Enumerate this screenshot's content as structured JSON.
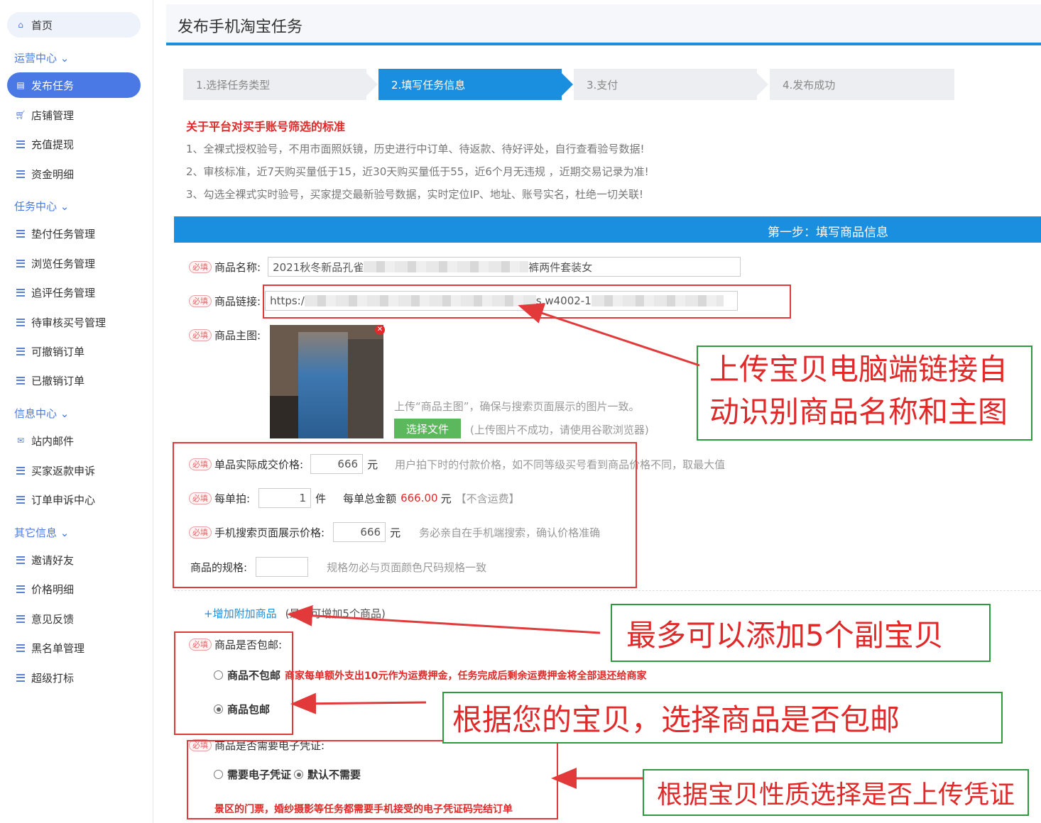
{
  "sidebar": {
    "home": "首页",
    "groups": [
      "运营中心",
      "任务中心",
      "信息中心",
      "其它信息"
    ],
    "ops": [
      "发布任务",
      "店铺管理",
      "充值提现",
      "资金明细"
    ],
    "tasks": [
      "垫付任务管理",
      "浏览任务管理",
      "追评任务管理",
      "待审核买号管理",
      "可撤销订单",
      "已撤销订单"
    ],
    "info": [
      "站内邮件",
      "买家返款申诉",
      "订单申诉中心"
    ],
    "other": [
      "邀请好友",
      "价格明细",
      "意见反馈",
      "黑名单管理",
      "超级打标"
    ]
  },
  "page": {
    "title": "发布手机淘宝任务",
    "steps": [
      "1.选择任务类型",
      "2.填写任务信息",
      "3.支付",
      "4.发布成功"
    ],
    "active_step": 1
  },
  "notice": {
    "title": "关于平台对买手账号筛选的标准",
    "lines": [
      "1、全裸式授权验号，不用市面照妖镜，历史进行中订单、待返款、待好评处，自行查看验号数据!",
      "2、审核标准，近7天购买量低于15，近30天购买量低于55，近6个月无违规 ，近期交易记录为准!",
      "3、勾选全裸式实时验号，买家提交最新验号数据，实时定位IP、地址、账号实名，杜绝一切关联!"
    ]
  },
  "section_title": "第一步：填写商品信息",
  "form": {
    "required_tag": "必填",
    "name_label": "商品名称:",
    "name_value_start": "2021秋冬新品孔雀",
    "name_value_end": "裤两件套装女",
    "link_label": "商品链接:",
    "link_value_start": "https:/",
    "link_value_mid": "s.w4002-1",
    "image_label": "商品主图:",
    "image_hint": "上传“商品主图”，确保与搜索页面展示的图片一致。",
    "choose_file": "选择文件",
    "upload_hint": "(上传图片不成功，请使用谷歌浏览器)",
    "price_label": "单品实际成交价格:",
    "price_value": "666",
    "price_unit": "元",
    "price_hint": "用户拍下时的付款价格，如不同等级买号看到商品价格不同，取最大值",
    "qty_label": "每单拍:",
    "qty_value": "1",
    "qty_unit": "件",
    "total_label": "每单总金额",
    "total_value": "666.00",
    "total_unit": "元",
    "total_note": "【不含运费】",
    "search_price_label": "手机搜索页面展示价格:",
    "search_price_value": "666",
    "search_price_unit": "元",
    "search_price_hint": "务必亲自在手机端搜索，确认价格准确",
    "spec_label": "商品的规格:",
    "spec_hint": "规格勿必与页面颜色尺码规格一致",
    "add_item": "+增加附加商品",
    "add_item_note": "(最多可增加5个商品)",
    "shipping_label": "商品是否包邮:",
    "shipping_no": "商品不包邮",
    "shipping_no_note": "商家每单额外支出10元作为运费押金，任务完成后剩余运费押金将全部退还给商家",
    "shipping_yes": "商品包邮",
    "voucher_label": "商品是否需要电子凭证:",
    "voucher_need": "需要电子凭证",
    "voucher_default": "默认不需要",
    "voucher_note": "景区的门票，婚纱摄影等任务都需要手机接受的电子凭证码完结订单"
  },
  "annotations": {
    "a1": "上传宝贝电脑端链接自动识别商品名称和主图",
    "a1_line1": "上传宝贝电脑端链接自",
    "a1_line2": "动识别商品名称和主图",
    "a2": "最多可以添加5个副宝贝",
    "a3": "根据您的宝贝，选择商品是否包邮",
    "a4": "根据宝贝性质选择是否上传凭证"
  },
  "colors": {
    "accent": "#1a8fe0",
    "sidebar_active": "#4a79e5",
    "required": "#e06666",
    "annotation_red": "#e02a2a",
    "annotation_green_border": "#2e9a3e"
  }
}
